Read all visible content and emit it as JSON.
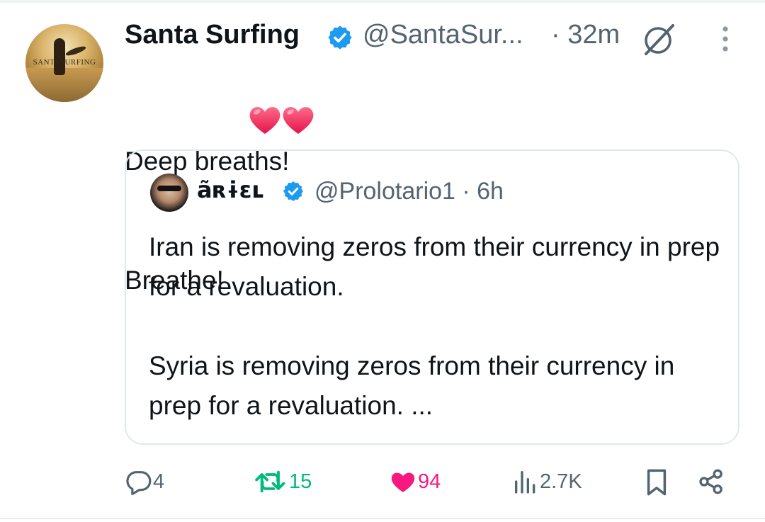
{
  "author": {
    "display_name": "Santa Surfing",
    "handle": "@SantaSur...",
    "time": "· 32m",
    "avatar_text": "SANTASURFING"
  },
  "tweet": {
    "line1": "Deep breaths!",
    "line2": "Breathe!",
    "emoji": "❤️❤️"
  },
  "quote": {
    "display_name": "ãʀɨɛʟ",
    "handle_time": "@Prolotario1 · 6h",
    "paragraph1": "Iran is removing zeros from their currency in prep for a revaluation.",
    "paragraph2": "Syria is removing zeros from their currency in prep for a revaluation. ..."
  },
  "actions": {
    "replies": "4",
    "reposts": "15",
    "likes": "94",
    "views": "2.7K"
  },
  "colors": {
    "verified": "#1d9bf0",
    "repost": "#00ba7c",
    "like": "#f91880",
    "secondary_text": "#536471"
  },
  "icons": [
    "verified-badge-icon",
    "grok-icon",
    "more-icon",
    "reply-icon",
    "repost-icon",
    "like-icon",
    "views-icon",
    "bookmark-icon",
    "share-icon"
  ]
}
